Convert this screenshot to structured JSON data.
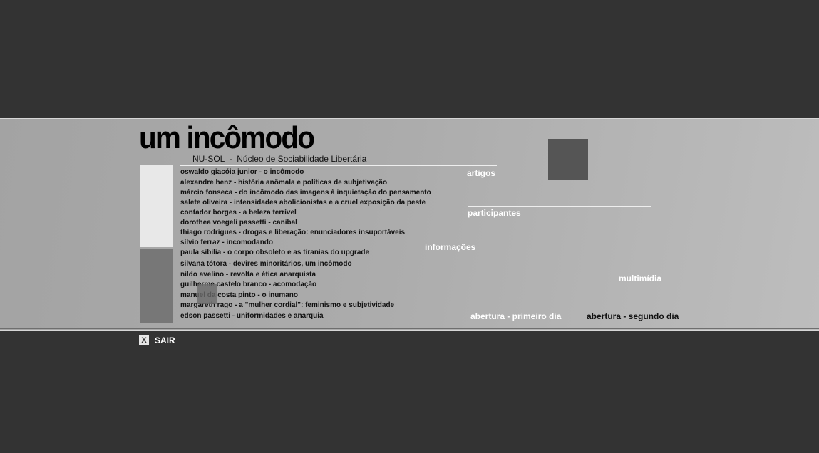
{
  "header": {
    "title": "um incômodo",
    "subtitle": "NU-SOL  -  Núcleo de Sociabilidade Libertária"
  },
  "articles": [
    "oswaldo giacóia junior - o incômodo",
    "alexandre henz - história anômala e políticas de subjetivação",
    "márcio fonseca - do incômodo das imagens à inquietação do pensamento",
    "salete oliveira - intensidades abolicionistas e a cruel exposição da peste",
    "contador borges - a beleza terrível",
    "dorothea voegeli passetti - canibal",
    "thiago rodrigues - drogas e liberação: enunciadores insuportáveis",
    "sílvio ferraz - incomodando",
    "paula sibilia - o corpo obsoleto e as tiranias do upgrade",
    "silvana tótora - devires minoritários, um incômodo",
    "nildo avelino - revolta e ética anarquista",
    "guilherme castelo branco - acomodação",
    "manuel da costa pinto - o inumano",
    "margareth rago - a \"mulher cordial\": feminismo e subjetividade",
    "edson passetti - uniformidades e anarquia"
  ],
  "nav": {
    "artigos": "artigos",
    "participantes": "participantes",
    "informacoes": "informações",
    "multimidia": "multimídia",
    "abertura_1": "abertura - primeiro dia",
    "abertura_2": "abertura - segundo dia"
  },
  "footer": {
    "exit_icon": "X",
    "exit_label": "SAIR"
  }
}
